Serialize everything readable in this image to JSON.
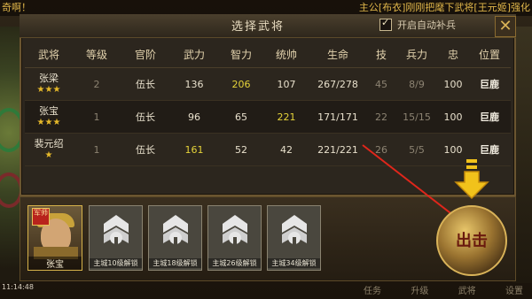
{
  "ticker": {
    "left": "奇啊！",
    "right": "主公[布衣]刚刚把麾下武将[王元姬]强化"
  },
  "dialog": {
    "title": "选择武将",
    "auto_refill_label": "开启自动补兵",
    "auto_refill_checked": true
  },
  "table": {
    "headers": [
      "武将",
      "等级",
      "官阶",
      "武力",
      "智力",
      "统帅",
      "生命",
      "技",
      "兵力",
      "忠",
      "位置"
    ],
    "rows": [
      {
        "name": "张梁",
        "stars": "★★★",
        "level": "2",
        "rank": "伍长",
        "force": "136",
        "intel": "206",
        "command": "107",
        "hp": "267/278",
        "skill": "45",
        "troops": "8/9",
        "loyalty": "100",
        "location": "巨鹿"
      },
      {
        "name": "张宝",
        "stars": "★★★",
        "level": "1",
        "rank": "伍长",
        "force": "96",
        "intel": "65",
        "command": "221",
        "hp": "171/171",
        "skill": "22",
        "troops": "15/15",
        "loyalty": "100",
        "location": "巨鹿"
      },
      {
        "name": "裴元绍",
        "stars": "★",
        "level": "1",
        "rank": "伍长",
        "force": "161",
        "intel": "52",
        "command": "42",
        "hp": "221/221",
        "skill": "26",
        "troops": "5/5",
        "loyalty": "100",
        "location": "巨鹿"
      }
    ]
  },
  "bottom": {
    "selected_hero": {
      "badge": "军师",
      "name": "张宝"
    },
    "locked_slots": [
      "主城10级解锁",
      "主城18级解锁",
      "主城26级解锁",
      "主城34级解锁"
    ],
    "attack_label": "出击"
  },
  "clock": "11:14:48",
  "footer_nav": [
    "任务",
    "升级",
    "武将",
    "设置"
  ],
  "colors": {
    "highlight": "#e5d33a",
    "gold": "#d9b357",
    "text": "#e8e0cc"
  }
}
